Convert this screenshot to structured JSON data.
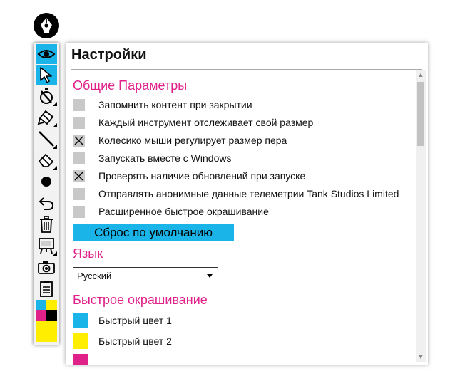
{
  "settings": {
    "title": "Настройки",
    "general_heading": "Общие Параметры",
    "options": [
      {
        "label": "Запомнить контент при закрытии",
        "checked": false
      },
      {
        "label": "Каждый инструмент отслеживает свой размер",
        "checked": false
      },
      {
        "label": "Колесико мыши регулирует размер пера",
        "checked": true
      },
      {
        "label": "Запускать вместе с Windows",
        "checked": false
      },
      {
        "label": "Проверять наличие обновлений при запуске",
        "checked": true
      },
      {
        "label": "Отправлять анонимные данные телеметрии Tank Studios Limited",
        "checked": false
      },
      {
        "label": "Расширенное быстрое окрашивание",
        "checked": false
      }
    ],
    "reset_label": "Сброс по умолчанию",
    "language_heading": "Язык",
    "language_selected": "Русский",
    "quick_color_heading": "Быстрое окрашивание",
    "quick_colors": [
      {
        "label": "Быстрый цвет 1",
        "color": "#1ab4e8"
      },
      {
        "label": "Быстрый цвет 2",
        "color": "#ffee00"
      },
      {
        "label": "",
        "color": "#e0218a"
      }
    ]
  },
  "toolbar": {
    "tools": [
      {
        "name": "eye-icon",
        "active": true
      },
      {
        "name": "cursor-icon",
        "active": true
      },
      {
        "name": "pen-icon",
        "active": false
      },
      {
        "name": "highlighter-icon",
        "active": false
      },
      {
        "name": "line-icon",
        "active": false
      },
      {
        "name": "eraser-icon",
        "active": false
      },
      {
        "name": "dot-icon",
        "active": false
      },
      {
        "name": "undo-icon",
        "active": false
      },
      {
        "name": "trash-icon",
        "active": false
      },
      {
        "name": "board-icon",
        "active": false
      },
      {
        "name": "camera-icon",
        "active": false
      },
      {
        "name": "clipboard-icon",
        "active": false
      }
    ],
    "palette": [
      "#1ab4e8",
      "#ffee00",
      "#e0218a",
      "#000000",
      "#ffee00",
      "#ffee00"
    ]
  },
  "colors": {
    "accent": "#1ab4e8",
    "heading": "#e0218a",
    "checkbox": "#c8c8c8"
  }
}
